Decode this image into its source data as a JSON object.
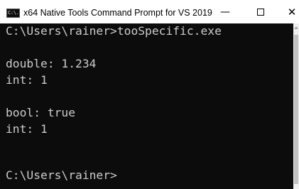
{
  "window": {
    "title": "x64 Native Tools Command Prompt for VS 2019",
    "icon": "cmd-icon",
    "icon_text": "C:\\.",
    "controls": {
      "minimize": "—",
      "maximize": "maximize-icon",
      "close": "✕"
    }
  },
  "console": {
    "lines": [
      "C:\\Users\\rainer>tooSpecific.exe",
      "",
      "double: 1.234",
      "int: 1",
      "",
      "bool: true",
      "int: 1",
      "",
      "",
      "C:\\Users\\rainer>"
    ]
  },
  "colors": {
    "console_background": "#0c0c0c",
    "console_text": "#cccccc",
    "titlebar": "#ffffff"
  }
}
